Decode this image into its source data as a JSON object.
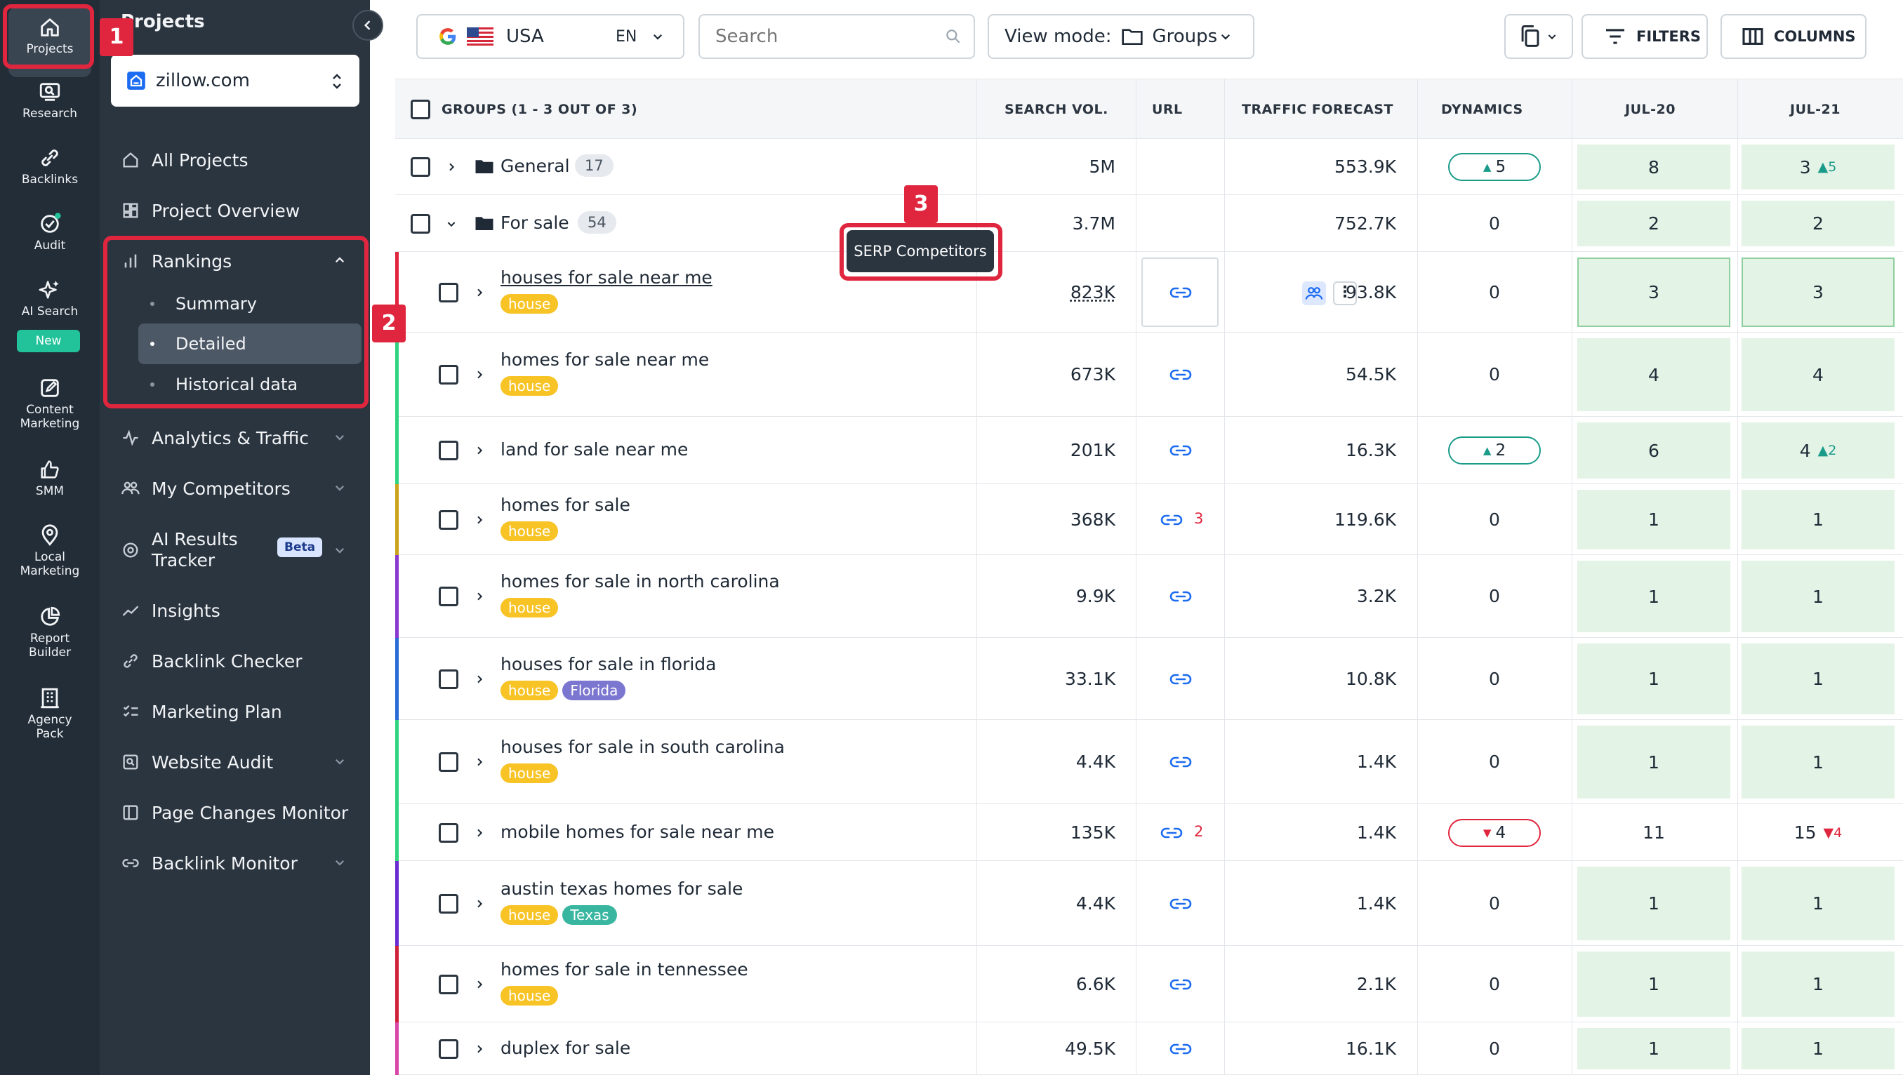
{
  "rail": {
    "items": [
      {
        "label": "Projects",
        "icon": "home-icon"
      },
      {
        "label": "Research",
        "icon": "research-icon"
      },
      {
        "label": "Backlinks",
        "icon": "link-icon"
      },
      {
        "label": "Audit",
        "icon": "check-circle-icon"
      },
      {
        "label": "AI Search",
        "icon": "sparkle-icon"
      },
      {
        "label": "Content Marketing",
        "icon": "edit-icon"
      },
      {
        "label": "SMM",
        "icon": "thumbs-up-icon"
      },
      {
        "label": "Local Marketing",
        "icon": "map-pin-icon"
      },
      {
        "label": "Report Builder",
        "icon": "pie-chart-icon"
      },
      {
        "label": "Agency Pack",
        "icon": "building-icon"
      }
    ],
    "new_badge": "New",
    "content_lines": [
      "Content",
      "Marketing"
    ],
    "local_lines": [
      "Local",
      "Marketing"
    ],
    "report_lines": [
      "Report",
      "Builder"
    ],
    "agency_lines": [
      "Agency",
      "Pack"
    ]
  },
  "nav": {
    "heading": "Projects",
    "project": "zillow.com",
    "items": {
      "all_projects": "All Projects",
      "overview": "Project Overview",
      "rankings": "Rankings",
      "summary": "Summary",
      "detailed": "Detailed",
      "historical": "Historical data",
      "analytics": "Analytics & Traffic",
      "competitors": "My Competitors",
      "ai_results_1": "AI Results",
      "ai_results_2": "Tracker",
      "beta": "Beta",
      "insights": "Insights",
      "backlink_checker": "Backlink Checker",
      "marketing_plan": "Marketing Plan",
      "website_audit": "Website Audit",
      "page_changes": "Page Changes Monitor",
      "backlink_monitor": "Backlink Monitor"
    }
  },
  "toolbar": {
    "country": "USA",
    "lang": "EN",
    "search_placeholder": "Search",
    "view_mode_label": "View mode:",
    "view_mode_value": "Groups",
    "filters": "FILTERS",
    "columns": "COLUMNS"
  },
  "table": {
    "headers": {
      "groups": "GROUPS (1 - 3 OUT OF 3)",
      "search_vol": "SEARCH VOL.",
      "url": "URL",
      "traffic": "TRAFFIC FORECAST",
      "dynamics": "DYNAMICS",
      "jul20": "JUL-20",
      "jul21": "JUL-21"
    },
    "groups": [
      {
        "name": "General",
        "count": "17",
        "vol": "5M",
        "traffic": "553.9K",
        "dyn": "5",
        "jul20": "8",
        "jul21": "3",
        "jul21_delta": "5"
      },
      {
        "name": "For sale",
        "count": "54",
        "vol": "3.7M",
        "traffic": "752.7K",
        "dyn": "0",
        "jul20": "2",
        "jul21": "2"
      }
    ],
    "rows": [
      {
        "kw": "houses for sale near me",
        "tags": [
          "house"
        ],
        "vol": "823K",
        "traffic": "93.8K",
        "dyn": "0",
        "jul20": "3",
        "jul21": "3"
      },
      {
        "kw": "homes for sale near me",
        "tags": [
          "house"
        ],
        "vol": "673K",
        "traffic": "54.5K",
        "dyn": "0",
        "jul20": "4",
        "jul21": "4"
      },
      {
        "kw": "land for sale near me",
        "tags": [],
        "vol": "201K",
        "traffic": "16.3K",
        "dyn": "2",
        "jul20": "6",
        "jul21": "4",
        "jul21_delta": "2"
      },
      {
        "kw": "homes for sale",
        "tags": [
          "house"
        ],
        "vol": "368K",
        "traffic": "119.6K",
        "dyn": "0",
        "jul20": "1",
        "jul21": "1",
        "url_count": "3"
      },
      {
        "kw": "homes for sale in north carolina",
        "tags": [
          "house"
        ],
        "vol": "9.9K",
        "traffic": "3.2K",
        "dyn": "0",
        "jul20": "1",
        "jul21": "1"
      },
      {
        "kw": "houses for sale in florida",
        "tags": [
          "house",
          "Florida"
        ],
        "vol": "33.1K",
        "traffic": "10.8K",
        "dyn": "0",
        "jul20": "1",
        "jul21": "1"
      },
      {
        "kw": "houses for sale in south carolina",
        "tags": [
          "house"
        ],
        "vol": "4.4K",
        "traffic": "1.4K",
        "dyn": "0",
        "jul20": "1",
        "jul21": "1"
      },
      {
        "kw": "mobile homes for sale near me",
        "tags": [],
        "vol": "135K",
        "traffic": "1.4K",
        "dyn": "4",
        "jul20": "11",
        "jul21": "15",
        "jul21_delta": "4",
        "url_count": "2"
      },
      {
        "kw": "austin texas homes for sale",
        "tags": [
          "house",
          "Texas"
        ],
        "vol": "4.4K",
        "traffic": "1.4K",
        "dyn": "0",
        "jul20": "1",
        "jul21": "1"
      },
      {
        "kw": "homes for sale in tennessee",
        "tags": [
          "house"
        ],
        "vol": "6.6K",
        "traffic": "2.1K",
        "dyn": "0",
        "jul20": "1",
        "jul21": "1"
      },
      {
        "kw": "duplex for sale",
        "tags": [],
        "vol": "49.5K",
        "traffic": "16.1K",
        "dyn": "0",
        "jul20": "1",
        "jul21": "1"
      }
    ]
  },
  "tooltip": "SERP Competitors",
  "callouts": [
    "1",
    "2",
    "3"
  ],
  "colors": {
    "rail_bg": "#222d38",
    "nav_bg": "#2b3540",
    "highlight": "#e0263e",
    "rank_bg": "#e3f3e6",
    "tag_house": "#f7c325",
    "tag_florida": "#7b76cf",
    "tag_texas": "#38b6a0"
  }
}
